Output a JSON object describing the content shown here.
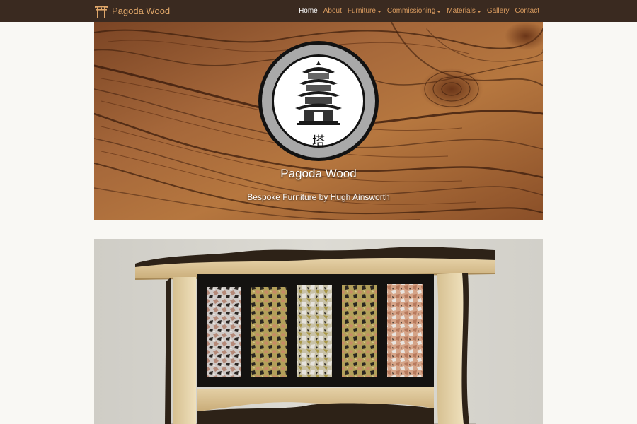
{
  "navbar": {
    "brand": "Pagoda Wood",
    "brand_icon": "torii-gate-icon",
    "items": [
      {
        "label": "Home",
        "active": true,
        "dropdown": false
      },
      {
        "label": "About",
        "active": false,
        "dropdown": false
      },
      {
        "label": "Furniture",
        "active": false,
        "dropdown": true
      },
      {
        "label": "Commissioning",
        "active": false,
        "dropdown": true
      },
      {
        "label": "Materials",
        "active": false,
        "dropdown": true
      },
      {
        "label": "Gallery",
        "active": false,
        "dropdown": false
      },
      {
        "label": "Contact",
        "active": false,
        "dropdown": false
      }
    ]
  },
  "hero": {
    "title": "Pagoda Wood",
    "subtitle": "Bespoke Furniture by Hugh Ainsworth",
    "logo_glyph": "塔"
  },
  "colors": {
    "navbar_bg": "#3a2a20",
    "nav_link": "#d99b5f",
    "nav_active": "#ffffff",
    "page_bg": "#f9f8f4"
  }
}
